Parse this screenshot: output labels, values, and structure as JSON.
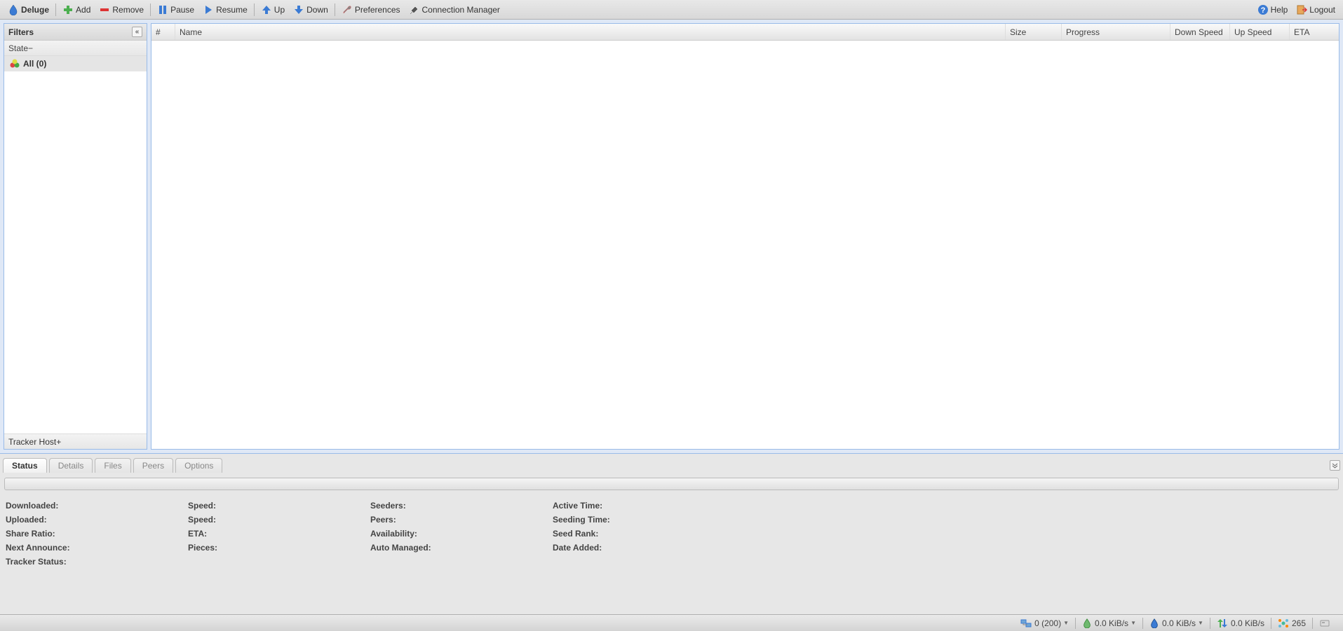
{
  "app": {
    "title": "Deluge"
  },
  "toolbar": {
    "add": "Add",
    "remove": "Remove",
    "pause": "Pause",
    "resume": "Resume",
    "up": "Up",
    "down": "Down",
    "preferences": "Preferences",
    "connection_manager": "Connection Manager",
    "help": "Help",
    "logout": "Logout"
  },
  "sidebar": {
    "title": "Filters",
    "state_header": "State",
    "all_label": "All (0)",
    "tracker_header": "Tracker Host"
  },
  "grid": {
    "columns": [
      "#",
      "Name",
      "Size",
      "Progress",
      "Down Speed",
      "Up Speed",
      "ETA"
    ]
  },
  "tabs": {
    "status": "Status",
    "details": "Details",
    "files": "Files",
    "peers": "Peers",
    "options": "Options"
  },
  "status": {
    "downloaded": "Downloaded:",
    "uploaded": "Uploaded:",
    "share_ratio": "Share Ratio:",
    "next_announce": "Next Announce:",
    "tracker_status": "Tracker Status:",
    "speed1": "Speed:",
    "speed2": "Speed:",
    "eta": "ETA:",
    "pieces": "Pieces:",
    "seeders": "Seeders:",
    "peers": "Peers:",
    "availability": "Availability:",
    "auto_managed": "Auto Managed:",
    "active_time": "Active Time:",
    "seeding_time": "Seeding Time:",
    "seed_rank": "Seed Rank:",
    "date_added": "Date Added:"
  },
  "statusbar": {
    "connections": "0 (200)",
    "down_speed": "0.0 KiB/s",
    "up_speed": "0.0 KiB/s",
    "protocol": "0.0 KiB/s",
    "dht": "265"
  }
}
